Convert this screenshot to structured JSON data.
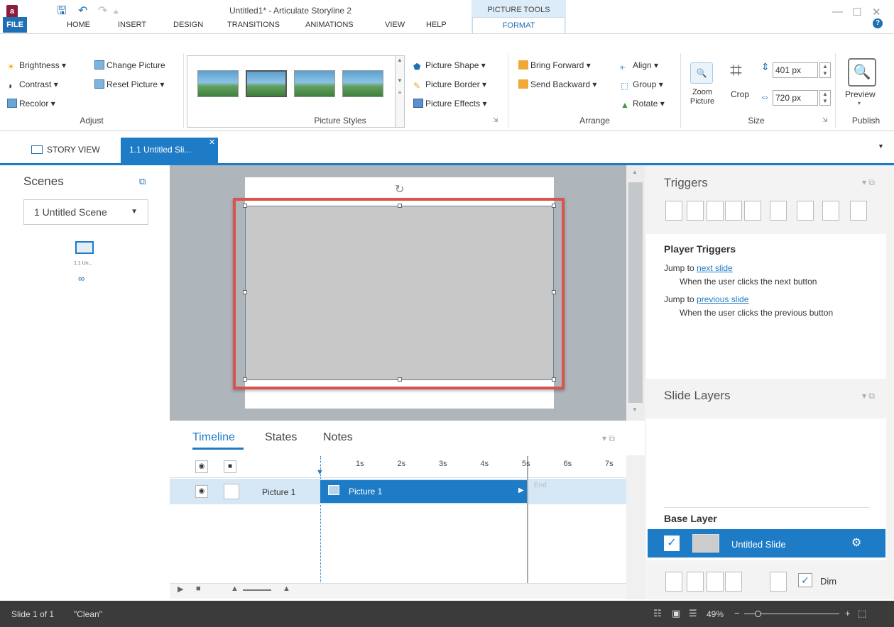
{
  "window": {
    "title": "Untitled1* -  Articulate Storyline 2",
    "context_tab_group": "PICTURE TOOLS",
    "app_icon": "a",
    "minimize": "—",
    "maximize": "☐",
    "close": "✕"
  },
  "menu": [
    "FILE",
    "HOME",
    "INSERT",
    "DESIGN",
    "TRANSITIONS",
    "ANIMATIONS",
    "VIEW",
    "HELP",
    "FORMAT"
  ],
  "ribbon": {
    "adjust": {
      "label": "Adjust",
      "brightness": "Brightness",
      "contrast": "Contrast",
      "recolor": "Recolor",
      "change_picture": "Change Picture",
      "reset_picture": "Reset Picture"
    },
    "styles": {
      "label": "Picture Styles",
      "shape": "Picture Shape",
      "border": "Picture Border",
      "effects": "Picture Effects"
    },
    "arrange": {
      "label": "Arrange",
      "bring_forward": "Bring Forward",
      "send_backward": "Send Backward",
      "align": "Align",
      "group": "Group",
      "rotate": "Rotate"
    },
    "size": {
      "label": "Size",
      "zoom_line1": "Zoom",
      "zoom_line2": "Picture",
      "crop": "Crop",
      "height": "401 px",
      "width": "720 px"
    },
    "publish": {
      "label": "Publish",
      "preview": "Preview"
    }
  },
  "tabs": {
    "story_view": "STORY VIEW",
    "slide_tab": "1.1 Untitled Sli..."
  },
  "scenes": {
    "title": "Scenes",
    "dropdown": "1 Untitled Scene",
    "thumb_label": "1.1 Un..."
  },
  "triggers": {
    "title": "Triggers",
    "player_triggers": "Player Triggers",
    "items": [
      {
        "action": "Jump to",
        "target": "next slide",
        "condition": "When the user clicks the next button"
      },
      {
        "action": "Jump to",
        "target": "previous slide",
        "condition": "When the user clicks the previous button"
      }
    ]
  },
  "layers": {
    "title": "Slide Layers",
    "base_layer": "Base Layer",
    "slide_name": "Untitled Slide",
    "dim": "Dim"
  },
  "timeline": {
    "tabs": [
      "Timeline",
      "States",
      "Notes"
    ],
    "ticks": [
      "1s",
      "2s",
      "3s",
      "4s",
      "5s",
      "6s",
      "7s"
    ],
    "row_name": "Picture 1",
    "bar_label": "Picture 1",
    "end_label": "End"
  },
  "status": {
    "slide": "Slide 1 of 1",
    "theme": "\"Clean\"",
    "zoom": "49%"
  },
  "colors": {
    "accent": "#1e7bc6",
    "highlight": "#d9534f",
    "status_bg": "#3b3b3b"
  }
}
